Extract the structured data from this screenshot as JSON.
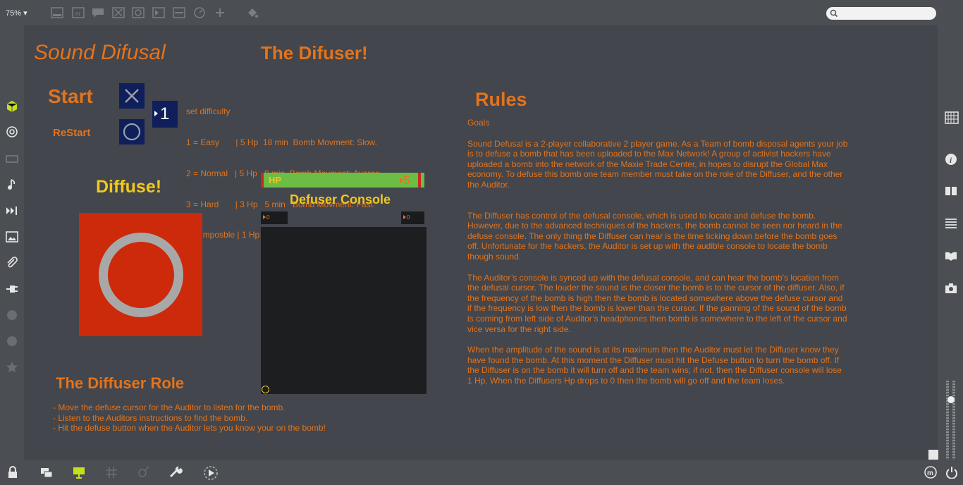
{
  "toolbar": {
    "zoom": "75%",
    "zoom_caret": "▾",
    "search_placeholder": ""
  },
  "patch": {
    "title": "Sound Difusal",
    "subtitle": "The Difuser!",
    "start_label": "Start",
    "restart_label": "ReStart",
    "difficulty_value": "1",
    "difficulty_lines": [
      "set difficulty",
      "1 = Easy       | 5 Hp  18 min  Bomb Movment: Slow.",
      "2 = Normal   | 5 Hp   8 min  Bomb Movment: Avarge.",
      "3 = Hard       | 3 Hp   5 min   Bomb Movment: Fast.",
      "4 = Imposble | 1 Hp   2 min   Bomb Movment: Very Fast!"
    ],
    "diffuse_label": "Diffuse!",
    "hp_label": "HP",
    "hp_value": "5",
    "console_label": "Defuser Console",
    "coord_x": "0",
    "coord_y": "0",
    "role_title": "The Diffuser Role",
    "role_lines": [
      "- Move the defuse cursor for the Auditor to listen for the bomb.",
      "- Listen to the Auditors instructions to find the bomb.",
      "- Hit the defuse button when the Auditor lets you know your on the bomb!"
    ],
    "rules_title": "Rules",
    "rules_goals": "Goals",
    "rules_p1": "Sound Defusal is a 2-player collaborative 2 player game. As a Team of bomb disposal agents your job is to defuse a bomb that has been uploaded to the Max Network! A group of activist hackers have uploaded a bomb into the network of the Maxie Trade Center, in hopes to disrupt the Global Max economy.  To defuse this bomb one team member must take on the role of the Diffuser, and the other the Auditor.",
    "rules_p2": "The Diffuser has control of the defusal console, which is used to locate and defuse the bomb. However, due to the advanced techniques of the hackers, the bomb cannot be seen nor heard in the defuse console. The only thing the Diffuser can hear is the time ticking down before the bomb goes off. Unfortunate for the hackers, the Auditor is set up with the audible console to locate the bomb though sound.",
    "rules_p3": "The Auditor’s console is synced up with the defusal console, and can hear the bomb’s location from the defusal cursor. The louder the sound is the closer the bomb is to the cursor of the diffuser. Also, if the frequency of the bomb is high then the bomb is located somewhere above the defuse cursor and if the frequency is low then the bomb is lower than the cursor. If the panning of the sound of the bomb is coming from left side of Auditor’s headphones then bomb is somewhere to the left of the cursor and vice versa for the right side.",
    "rules_p4": "When the amplitude of the sound is at its maximum then the Auditor must let the Diffuser know they have found the bomb. At this moment the Diffuser must hit the Defuse button to turn the bomb off. If the Diffuser is on the bomb it will turn off and the team wins; if not, then the Diffuser console will lose 1 Hp. When the Diffusers Hp drops to 0 then the bomb will go off and the team loses."
  },
  "colors": {
    "accent": "#e3731c",
    "yellow": "#f2c81c",
    "button_blue": "#0e1f5c",
    "bomb_red": "#cc2a0a",
    "hp_green": "#6bbd45"
  }
}
